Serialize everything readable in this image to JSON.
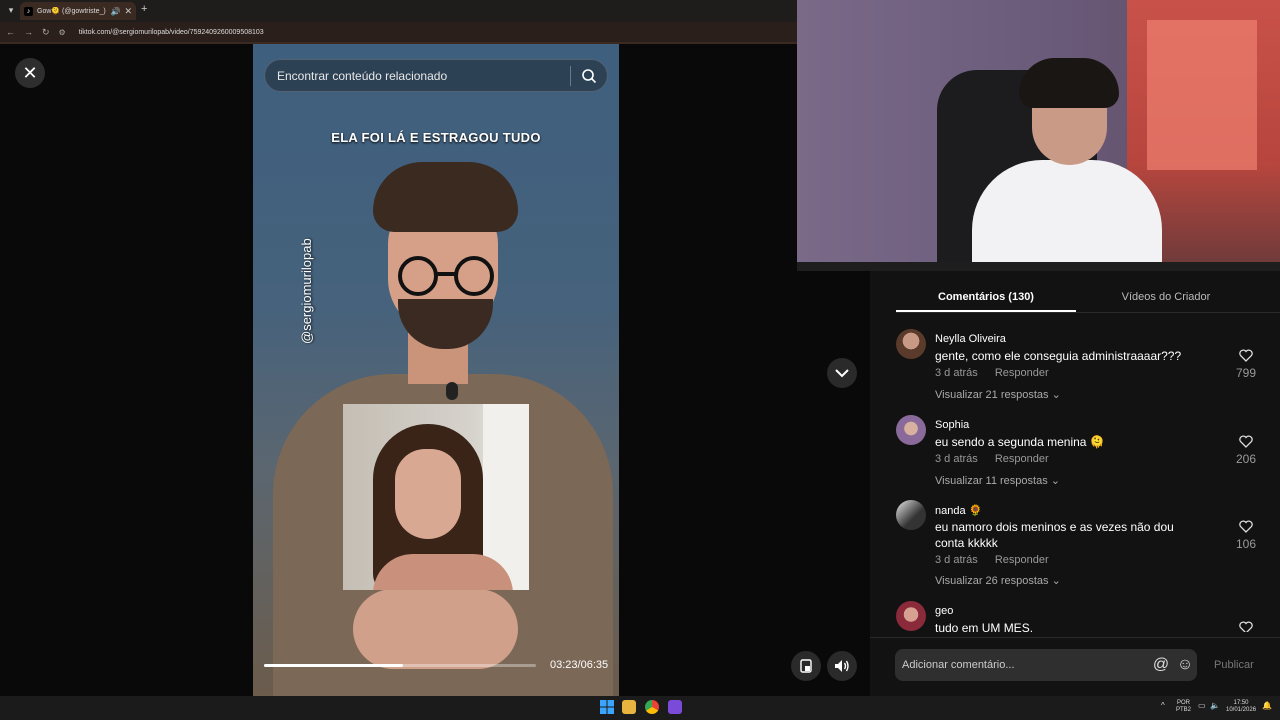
{
  "browser": {
    "tab_title": "Gow🫠 (@gowtriste_) | Tik",
    "url": "tiktok.com/@sergiomurilopab/video/7592409260009508103",
    "tab_menu_icon": "chevron-down-icon",
    "new_tab_label": "+"
  },
  "search": {
    "placeholder": "Encontrar conteúdo relacionado"
  },
  "video": {
    "caption": "ELA FOI LÁ E ESTRAGOU TUDO",
    "watermark": "@sergiomurilopab",
    "time": "03:23/06:35",
    "progress": 0.51
  },
  "comments_panel": {
    "tabs": [
      {
        "label": "Comentários (130)"
      },
      {
        "label": "Vídeos do Criador"
      }
    ],
    "comments": [
      {
        "name": "Neylla Oliveira",
        "text": "gente, como ele conseguia administraaaar???",
        "time": "3 d atrás",
        "reply": "Responder",
        "replies": "Visualizar 21 respostas",
        "likes": "799"
      },
      {
        "name": "Sophia",
        "text": "eu sendo a segunda menina 🫠",
        "time": "3 d atrás",
        "reply": "Responder",
        "replies": "Visualizar 11 respostas",
        "likes": "206"
      },
      {
        "name": "nanda 🌻",
        "text": "eu namoro dois meninos e as vezes não dou conta kkkkk",
        "time": "3 d atrás",
        "reply": "Responder",
        "replies": "Visualizar 26 respostas",
        "likes": "106"
      },
      {
        "name": "geo",
        "text": "tudo em UM MES.",
        "time": "",
        "reply": "",
        "replies": "",
        "likes": ""
      }
    ],
    "add_comment_placeholder": "Adicionar comentário...",
    "publish_label": "Publicar"
  },
  "taskbar": {
    "lang_line1": "POR",
    "lang_line2": "PTB2",
    "clock_time": "17:50",
    "clock_date": "10/01/2026"
  },
  "colors": {
    "panel_bg": "#121212",
    "viewer_bg": "#090909",
    "muted_text": "#999999"
  }
}
